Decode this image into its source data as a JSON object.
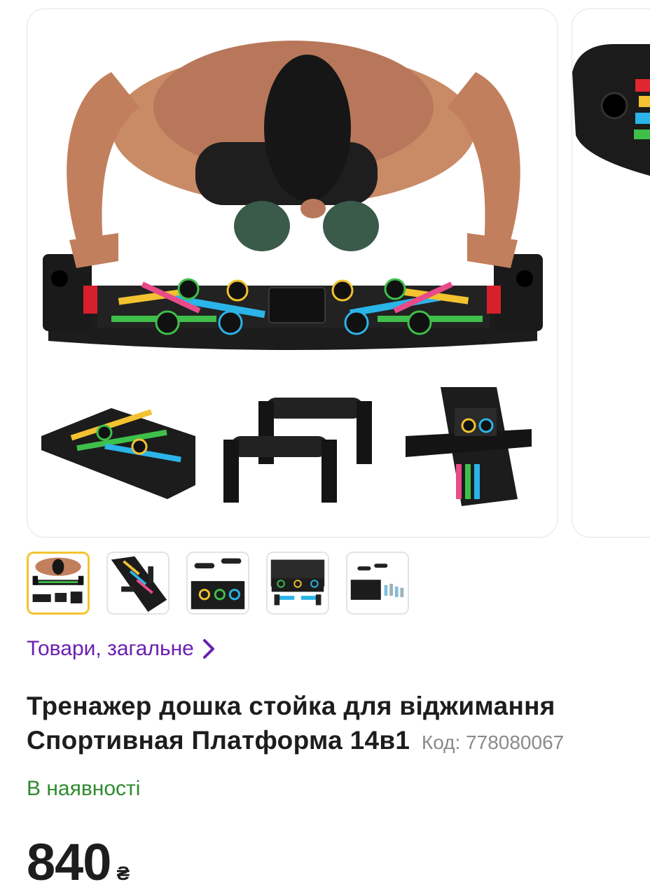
{
  "gallery": {
    "main_image_icon": "pushup-board-photo",
    "next_image_icon": "board-closeup-photo",
    "thumbnails": [
      {
        "icon": "pushup-man-thumbnail",
        "active": true
      },
      {
        "icon": "board-handles-thumbnail",
        "active": false
      },
      {
        "icon": "handles-board-thumbnail",
        "active": false
      },
      {
        "icon": "board-bands-thumbnail",
        "active": false
      },
      {
        "icon": "kit-contents-thumbnail",
        "active": false
      }
    ]
  },
  "breadcrumb": {
    "label": "Товари, загальне",
    "icon": "chevron-right-icon",
    "color": "#6b1fb1"
  },
  "product": {
    "title": "Тренажер дошка стойка для віджимання Спортивная Платформа 14в1",
    "code_label": "Код: 778080067",
    "availability": "В наявності",
    "availability_color": "#2e8b2e",
    "price": "840",
    "currency": "₴"
  }
}
